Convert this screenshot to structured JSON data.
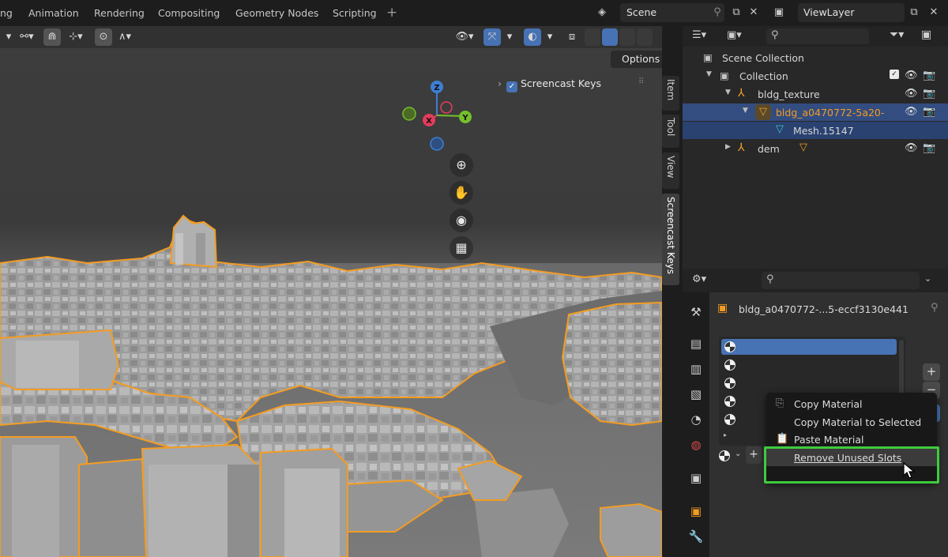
{
  "top_bar": {
    "workspace_tabs": [
      "ng",
      "Animation",
      "Rendering",
      "Compositing",
      "Geometry Nodes",
      "Scripting"
    ],
    "scene_label": "Scene",
    "viewlayer_label": "ViewLayer"
  },
  "viewport": {
    "options_label": "Options",
    "screencast_keys_label": "Screencast Keys",
    "gizmo_axes": {
      "x": "X",
      "y": "Y",
      "z": "Z"
    },
    "npanel_tabs": [
      "Item",
      "Tool",
      "View",
      "Screencast Keys"
    ],
    "colors": {
      "x_axis": "#e23d5b",
      "y_axis": "#74c02a",
      "z_axis": "#3e7fd6",
      "selection_outline": "#f39c22",
      "building": "#a4a4a4"
    }
  },
  "outliner": {
    "rows": [
      {
        "label": "Scene Collection"
      },
      {
        "label": "Collection"
      },
      {
        "label": "bldg_texture"
      },
      {
        "label": "bldg_a0470772-5a20-"
      },
      {
        "label": "Mesh.15147"
      },
      {
        "label": "dem"
      }
    ]
  },
  "properties": {
    "object_name": "bldg_a0470772-...5-eccf3130e441",
    "slot_count": 5
  },
  "context_menu": {
    "items": [
      {
        "label": "Copy Material"
      },
      {
        "label": "Copy Material to Selected"
      },
      {
        "label": "Paste Material"
      },
      {
        "label": "Remove Unused Slots"
      }
    ],
    "highlighted": "Remove Unused Slots"
  }
}
